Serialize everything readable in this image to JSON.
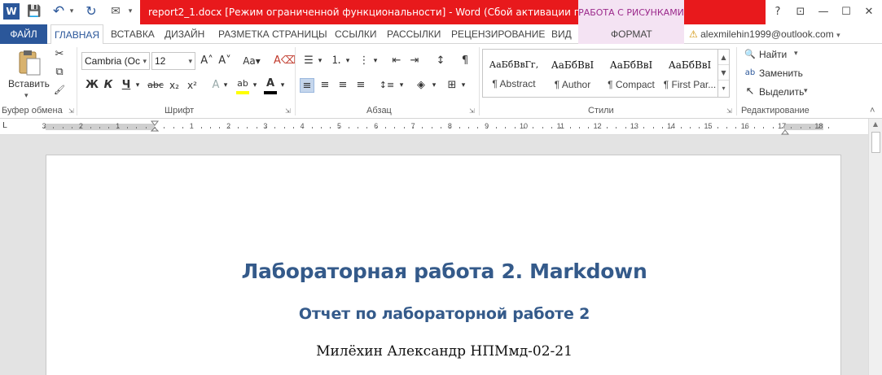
{
  "window": {
    "document_name": "report2_1.docx [Режим ограниченной функциональности] -  Word (Сбой активации продукта)",
    "contextual_title": "РАБОТА С РИСУНКАМИ",
    "help_glyph": "?",
    "ribbon_opts_glyph": "⊡",
    "minimize_glyph": "—",
    "restore_glyph": "☐",
    "close_glyph": "✕"
  },
  "quick_access": {
    "word_icon": "W",
    "save_icon": "save-icon",
    "undo_icon": "undo-icon",
    "redo_icon": "redo-icon",
    "save_glyph": "💾",
    "undo_glyph": "↶",
    "undo_dd": "▾",
    "redo_glyph": "↻",
    "extra_glyph": "✉",
    "customize_glyph": "▾"
  },
  "tabs": {
    "file": "ФАЙЛ",
    "items": [
      "ГЛАВНАЯ",
      "ВСТАВКА",
      "ДИЗАЙН",
      "РАЗМЕТКА СТРАНИЦЫ",
      "ССЫЛКИ",
      "РАССЫЛКИ",
      "РЕЦЕНЗИРОВАНИЕ",
      "ВИД"
    ],
    "format": "ФОРМАТ",
    "account": "alexmilehin1999@outlook.com",
    "account_dd": "▾",
    "account_warning": "⚠"
  },
  "clipboard": {
    "paste_label": "Вставить",
    "paste_dd": "▾",
    "group_label": "Буфер обмена",
    "cut_glyph": "✂",
    "copy_glyph": "⧉",
    "painter_glyph": "🖌",
    "launcher_glyph": "⇲"
  },
  "font": {
    "family": "Cambria (Ос",
    "size": "12",
    "group_label": "Шрифт",
    "dd_arrow": "▾",
    "grow_glyph": "A˄",
    "shrink_glyph": "A˅",
    "case_glyph": "Aa▾",
    "clear_glyph": "A⌫",
    "bold_glyph": "Ж",
    "italic_glyph": "К",
    "underline_glyph": "Ч",
    "underline_dd": "▾",
    "strike_glyph": "abc",
    "subscript_glyph": "x₂",
    "superscript_glyph": "x²",
    "effects_glyph": "A",
    "effects_dd": "▾",
    "highlight_glyph": "ab",
    "highlight_dd": "▾",
    "color_glyph": "A",
    "color_dd": "▾",
    "launcher_glyph": "⇲",
    "highlight_color": "#ffff00",
    "font_color": "#000000"
  },
  "paragraph": {
    "group_label": "Абзац",
    "bullets_glyph": "☰",
    "numbering_glyph": "⒈",
    "multilevel_glyph": "⋮",
    "dd": "▾",
    "outdent_glyph": "⇤",
    "indent_glyph": "⇥",
    "sort_glyph": "↕",
    "pilcrow_glyph": "¶",
    "align_left_glyph": "≡",
    "align_center_glyph": "≡",
    "align_right_glyph": "≡",
    "justify_glyph": "≡",
    "spacing_glyph": "↕≡",
    "shading_glyph": "◈",
    "borders_glyph": "⊞",
    "launcher_glyph": "⇲"
  },
  "styles": {
    "group_label": "Стили",
    "items": [
      {
        "sample": "АаБбВвГг,",
        "name": "¶ Abstract"
      },
      {
        "sample": "АаБбВвI",
        "name": "¶ Author"
      },
      {
        "sample": "АаБбВвI",
        "name": "¶ Compact"
      },
      {
        "sample": "АаБбВвI",
        "name": "¶ First Par..."
      }
    ],
    "scroll_up": "▲",
    "scroll_down": "▼",
    "more": "▾",
    "launcher_glyph": "⇲"
  },
  "editing": {
    "group_label": "Редактирование",
    "find_label": "Найти",
    "find_dd": "▾",
    "find_glyph": "🔍",
    "replace_label": "Заменить",
    "replace_glyph": "ab",
    "select_label": "Выделить",
    "select_dd": "▾",
    "select_glyph": "↖",
    "collapse_glyph": "˄"
  },
  "ruler": {
    "tab_selector": "L",
    "labels_left": [
      "3",
      "2",
      "1"
    ],
    "labels_right": [
      "1",
      "2",
      "3",
      "4",
      "5",
      "6",
      "7",
      "8",
      "9",
      "10",
      "11",
      "12",
      "13",
      "14",
      "15",
      "16",
      "17",
      "18"
    ]
  },
  "document": {
    "title": "Лабораторная работа 2. Markdown",
    "subtitle": "Отчет по лабораторной работе 2",
    "author": "Милёхин Александр НПМмд-02-21",
    "heading_color": "#345a8a"
  },
  "colors": {
    "file_tab": "#2b579a",
    "title_bar_warning": "#e8191c",
    "contextual_tab": "#f4e3f3",
    "contextual_text": "#9c2a8c"
  }
}
